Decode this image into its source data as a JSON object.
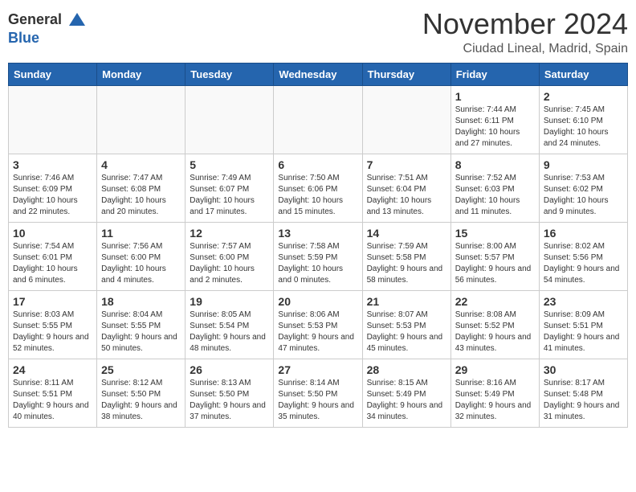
{
  "header": {
    "logo_general": "General",
    "logo_blue": "Blue",
    "month": "November 2024",
    "location": "Ciudad Lineal, Madrid, Spain"
  },
  "weekdays": [
    "Sunday",
    "Monday",
    "Tuesday",
    "Wednesday",
    "Thursday",
    "Friday",
    "Saturday"
  ],
  "weeks": [
    [
      {
        "day": "",
        "info": ""
      },
      {
        "day": "",
        "info": ""
      },
      {
        "day": "",
        "info": ""
      },
      {
        "day": "",
        "info": ""
      },
      {
        "day": "",
        "info": ""
      },
      {
        "day": "1",
        "info": "Sunrise: 7:44 AM\nSunset: 6:11 PM\nDaylight: 10 hours and 27 minutes."
      },
      {
        "day": "2",
        "info": "Sunrise: 7:45 AM\nSunset: 6:10 PM\nDaylight: 10 hours and 24 minutes."
      }
    ],
    [
      {
        "day": "3",
        "info": "Sunrise: 7:46 AM\nSunset: 6:09 PM\nDaylight: 10 hours and 22 minutes."
      },
      {
        "day": "4",
        "info": "Sunrise: 7:47 AM\nSunset: 6:08 PM\nDaylight: 10 hours and 20 minutes."
      },
      {
        "day": "5",
        "info": "Sunrise: 7:49 AM\nSunset: 6:07 PM\nDaylight: 10 hours and 17 minutes."
      },
      {
        "day": "6",
        "info": "Sunrise: 7:50 AM\nSunset: 6:06 PM\nDaylight: 10 hours and 15 minutes."
      },
      {
        "day": "7",
        "info": "Sunrise: 7:51 AM\nSunset: 6:04 PM\nDaylight: 10 hours and 13 minutes."
      },
      {
        "day": "8",
        "info": "Sunrise: 7:52 AM\nSunset: 6:03 PM\nDaylight: 10 hours and 11 minutes."
      },
      {
        "day": "9",
        "info": "Sunrise: 7:53 AM\nSunset: 6:02 PM\nDaylight: 10 hours and 9 minutes."
      }
    ],
    [
      {
        "day": "10",
        "info": "Sunrise: 7:54 AM\nSunset: 6:01 PM\nDaylight: 10 hours and 6 minutes."
      },
      {
        "day": "11",
        "info": "Sunrise: 7:56 AM\nSunset: 6:00 PM\nDaylight: 10 hours and 4 minutes."
      },
      {
        "day": "12",
        "info": "Sunrise: 7:57 AM\nSunset: 6:00 PM\nDaylight: 10 hours and 2 minutes."
      },
      {
        "day": "13",
        "info": "Sunrise: 7:58 AM\nSunset: 5:59 PM\nDaylight: 10 hours and 0 minutes."
      },
      {
        "day": "14",
        "info": "Sunrise: 7:59 AM\nSunset: 5:58 PM\nDaylight: 9 hours and 58 minutes."
      },
      {
        "day": "15",
        "info": "Sunrise: 8:00 AM\nSunset: 5:57 PM\nDaylight: 9 hours and 56 minutes."
      },
      {
        "day": "16",
        "info": "Sunrise: 8:02 AM\nSunset: 5:56 PM\nDaylight: 9 hours and 54 minutes."
      }
    ],
    [
      {
        "day": "17",
        "info": "Sunrise: 8:03 AM\nSunset: 5:55 PM\nDaylight: 9 hours and 52 minutes."
      },
      {
        "day": "18",
        "info": "Sunrise: 8:04 AM\nSunset: 5:55 PM\nDaylight: 9 hours and 50 minutes."
      },
      {
        "day": "19",
        "info": "Sunrise: 8:05 AM\nSunset: 5:54 PM\nDaylight: 9 hours and 48 minutes."
      },
      {
        "day": "20",
        "info": "Sunrise: 8:06 AM\nSunset: 5:53 PM\nDaylight: 9 hours and 47 minutes."
      },
      {
        "day": "21",
        "info": "Sunrise: 8:07 AM\nSunset: 5:53 PM\nDaylight: 9 hours and 45 minutes."
      },
      {
        "day": "22",
        "info": "Sunrise: 8:08 AM\nSunset: 5:52 PM\nDaylight: 9 hours and 43 minutes."
      },
      {
        "day": "23",
        "info": "Sunrise: 8:09 AM\nSunset: 5:51 PM\nDaylight: 9 hours and 41 minutes."
      }
    ],
    [
      {
        "day": "24",
        "info": "Sunrise: 8:11 AM\nSunset: 5:51 PM\nDaylight: 9 hours and 40 minutes."
      },
      {
        "day": "25",
        "info": "Sunrise: 8:12 AM\nSunset: 5:50 PM\nDaylight: 9 hours and 38 minutes."
      },
      {
        "day": "26",
        "info": "Sunrise: 8:13 AM\nSunset: 5:50 PM\nDaylight: 9 hours and 37 minutes."
      },
      {
        "day": "27",
        "info": "Sunrise: 8:14 AM\nSunset: 5:50 PM\nDaylight: 9 hours and 35 minutes."
      },
      {
        "day": "28",
        "info": "Sunrise: 8:15 AM\nSunset: 5:49 PM\nDaylight: 9 hours and 34 minutes."
      },
      {
        "day": "29",
        "info": "Sunrise: 8:16 AM\nSunset: 5:49 PM\nDaylight: 9 hours and 32 minutes."
      },
      {
        "day": "30",
        "info": "Sunrise: 8:17 AM\nSunset: 5:48 PM\nDaylight: 9 hours and 31 minutes."
      }
    ]
  ]
}
